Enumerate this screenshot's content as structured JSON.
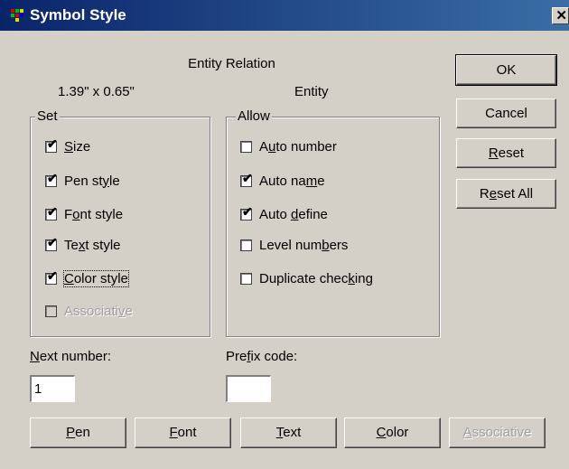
{
  "window": {
    "title": "Symbol Style",
    "close_glyph": "✕"
  },
  "header": {
    "symbol_name": "Entity Relation",
    "size_text": "1.39\" x 0.65\"",
    "entity_type": "Entity"
  },
  "set_group": {
    "legend": "Set",
    "items": [
      {
        "label": "Size",
        "checked": true,
        "enabled": true
      },
      {
        "label": "Pen style",
        "checked": true,
        "enabled": true
      },
      {
        "label": "Font style",
        "checked": true,
        "enabled": true
      },
      {
        "label": "Text style",
        "checked": true,
        "enabled": true
      },
      {
        "label": "Color style",
        "checked": true,
        "enabled": true
      },
      {
        "label": "Associative",
        "checked": false,
        "enabled": false
      }
    ]
  },
  "allow_group": {
    "legend": "Allow",
    "items": [
      {
        "label": "Auto number",
        "checked": false
      },
      {
        "label": "Auto name",
        "checked": true
      },
      {
        "label": "Auto define",
        "checked": true
      },
      {
        "label": "Level numbers",
        "checked": false
      },
      {
        "label": "Duplicate checking",
        "checked": false
      }
    ]
  },
  "side_buttons": {
    "ok": "OK",
    "cancel": "Cancel",
    "reset": "Reset",
    "reset_all": "Reset All"
  },
  "fields": {
    "next_number_label": "Next number:",
    "next_number_value": "1",
    "prefix_label": "Prefix code:",
    "prefix_value": ""
  },
  "bottom_buttons": {
    "pen": "Pen",
    "font": "Font",
    "text": "Text",
    "color": "Color",
    "associative": "Associative"
  },
  "check_glyph": "✔"
}
